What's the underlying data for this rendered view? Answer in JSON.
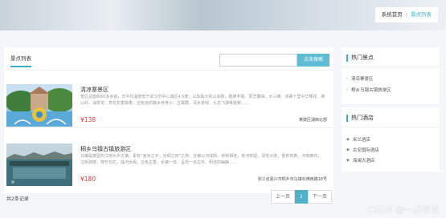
{
  "breadcrumb": {
    "home": "系统首页",
    "separator": "/",
    "current": "景点列表"
  },
  "main": {
    "tab_label": "景点列表",
    "search": {
      "placeholder": "",
      "button": "点击搜索"
    },
    "items": [
      {
        "title": "清凉寨景区",
        "desc": "景区总面积60多余亩，年平均温度低于武汉市中心城区4.6度；山体属大别山余脉，植被丰富，层峦叠嶂。大三峰、凉寨十里中华樱花、柳山红、油茶花、茶花花香飘香，还有远的藤水养育小、古寨群、清水翠绿、九龙飞瀑等景致……",
        "price": "¥138",
        "address": "黄陂区湖西北部"
      },
      {
        "title": "桐乡乌镇古镇旅游区",
        "desc": "乌镇是典型的江南水乡古镇，素有“鱼米之乡，丝绸之府”之称。全镇以河成街，桥街相连，依河筑屋，深宅大院，重脊高檐，河埠廊坊，过街骑楼，穿竹石栏，临河水阁，古色古香，水镇一体，呈现一派古朴、明洁的幽静……",
        "price": "¥180",
        "address": "浙江省嘉兴市桐乡市乌镇石佛南路18号"
      }
    ]
  },
  "pagination": {
    "total": "共2条记录",
    "prev": "上一页",
    "page": "1",
    "next": "下一页"
  },
  "sidebar": {
    "hot_spots": {
      "title": "热门景点",
      "items": [
        "清凉寨景区",
        "桐乡乌镇古镇旅游区"
      ]
    },
    "hot_hotels": {
      "title": "热门酒店",
      "items": [
        "米兰酒店",
        "古安国际酒店",
        "海澜大酒店"
      ]
    }
  },
  "watermark": "CSDN @一点毕设"
}
